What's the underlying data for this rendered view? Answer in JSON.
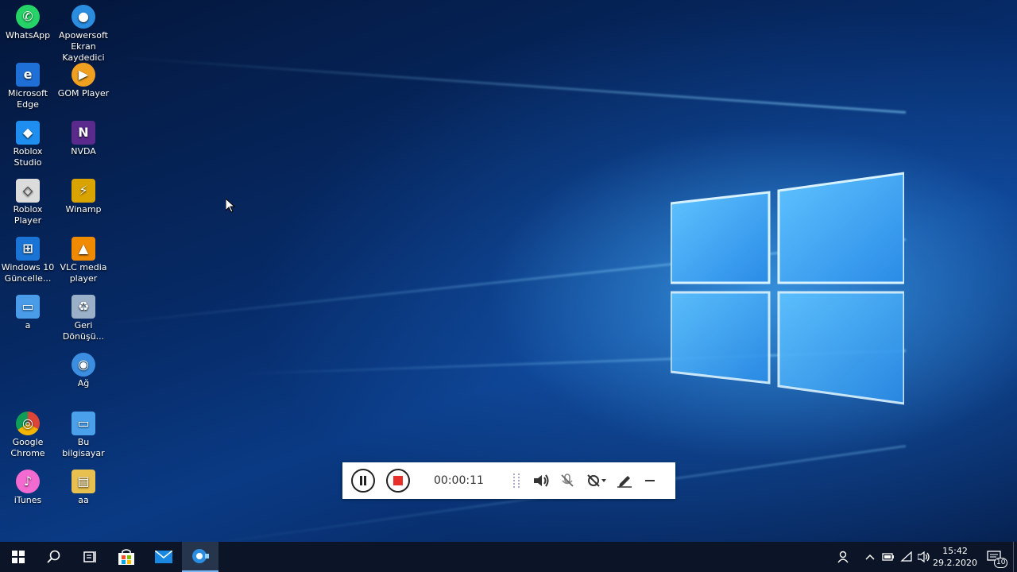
{
  "desktop": {
    "icons": [
      {
        "label": "WhatsApp",
        "color": "#25d366",
        "glyph": "✆"
      },
      {
        "label": "Apowersoft Ekran Kaydedici Pro",
        "color": "#2a8de0",
        "glyph": "●"
      },
      {
        "label": "Microsoft Edge",
        "color": "#1e6fd6",
        "glyph": "e"
      },
      {
        "label": "GOM Player",
        "color": "#f0a020",
        "glyph": "▶"
      },
      {
        "label": "Roblox Studio",
        "color": "#1e8ff0",
        "glyph": "◆"
      },
      {
        "label": "NVDA",
        "color": "#5a2a8c",
        "glyph": "N"
      },
      {
        "label": "Roblox Player",
        "color": "#dcdcdc",
        "glyph": "◇"
      },
      {
        "label": "Winamp",
        "color": "#d9a300",
        "glyph": "⚡"
      },
      {
        "label": "Windows 10 Güncelle...",
        "color": "#1a74d6",
        "glyph": "⊞"
      },
      {
        "label": "VLC media player",
        "color": "#f08a00",
        "glyph": "▲"
      },
      {
        "label": "a",
        "color": "#4a9be8",
        "glyph": "▭"
      },
      {
        "label": "Geri Dönüşü...",
        "color": "#9ab0c8",
        "glyph": "♻"
      },
      {
        "label": "Ağ",
        "color": "#3c8fe0",
        "glyph": "◉"
      },
      {
        "label": "Google Chrome",
        "color": "#db4437",
        "glyph": "◎"
      },
      {
        "label": "Bu bilgisayar",
        "color": "#4aa0ea",
        "glyph": "▭"
      },
      {
        "label": "iTunes",
        "color": "#f36ad0",
        "glyph": "♪"
      },
      {
        "label": "aa",
        "color": "#e8c050",
        "glyph": "▤"
      }
    ]
  },
  "recorder": {
    "time": "00:00:11",
    "stop_color": "#e8302a"
  },
  "taskbar": {
    "clock_time": "15:42",
    "clock_date": "29.2.2020",
    "notification_count": "10"
  }
}
